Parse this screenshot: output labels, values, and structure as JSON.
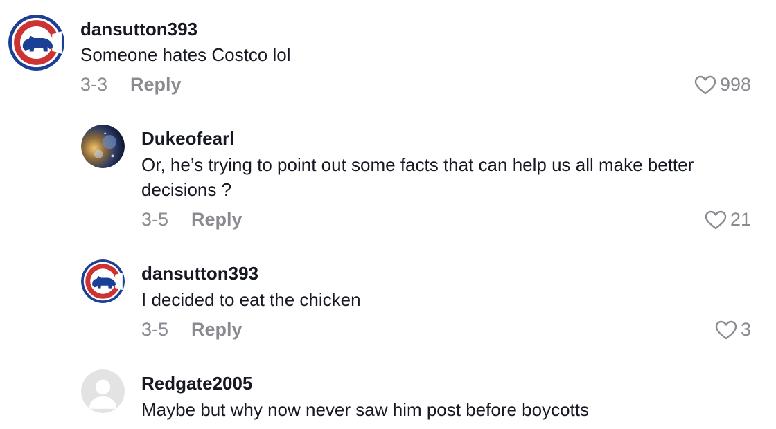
{
  "comments": [
    {
      "username": "dansutton393",
      "text": "Someone hates Costco lol",
      "date": "3-3",
      "reply_label": "Reply",
      "likes": "998",
      "avatar": "cubs-logo-icon"
    },
    {
      "username": "Dukeofearl",
      "text": "Or, he’s trying to point out some facts that can help us all make better decisions ?",
      "date": "3-5",
      "reply_label": "Reply",
      "likes": "21",
      "avatar": "galaxy-avatar-icon"
    },
    {
      "username": "dansutton393",
      "text": "I decided to eat the chicken",
      "date": "3-5",
      "reply_label": "Reply",
      "likes": "3",
      "avatar": "cubs-logo-icon"
    },
    {
      "username": "Redgate2005",
      "text": "Maybe but why now never saw him post before boycotts",
      "avatar": "default-avatar-icon"
    }
  ],
  "colors": {
    "primary_text": "#161823",
    "secondary_text": "#8a8b91",
    "cubs_blue": "#1b3f94",
    "cubs_red": "#cc3433"
  }
}
